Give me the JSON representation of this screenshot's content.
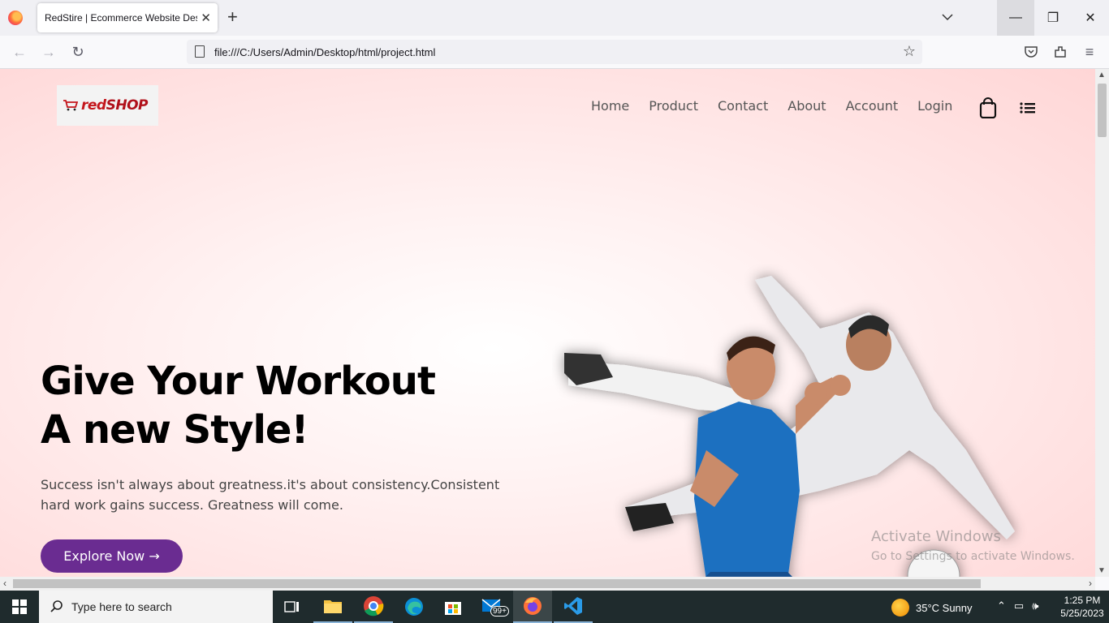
{
  "browser": {
    "tab_title": "RedStire | Ecommerce Website Desig",
    "url": "file:///C:/Users/Admin/Desktop/html/project.html"
  },
  "site": {
    "logo_red": "red",
    "logo_shop": "SHOP",
    "menu": [
      "Home",
      "Product",
      "Contact",
      "About",
      "Account",
      "Login"
    ],
    "hero_title_line1": "Give Your Workout",
    "hero_title_line2": "A new Style!",
    "hero_text_line1": "Success isn't always about greatness.it's about consistency.Consistent",
    "hero_text_line2": "hard work gains success. Greatness will come.",
    "cta": "Explore Now →",
    "accent_color": "#6a2c91",
    "icons": [
      "shopping-bag-icon",
      "menu-list-icon"
    ]
  },
  "watermark": {
    "line1": "Activate Windows",
    "line2": "Go to Settings to activate Windows."
  },
  "taskbar": {
    "search_placeholder": "Type here to search",
    "weather": "35°C  Sunny",
    "mail_badge": "99+",
    "time": "1:25 PM",
    "date": "5/25/2023"
  }
}
